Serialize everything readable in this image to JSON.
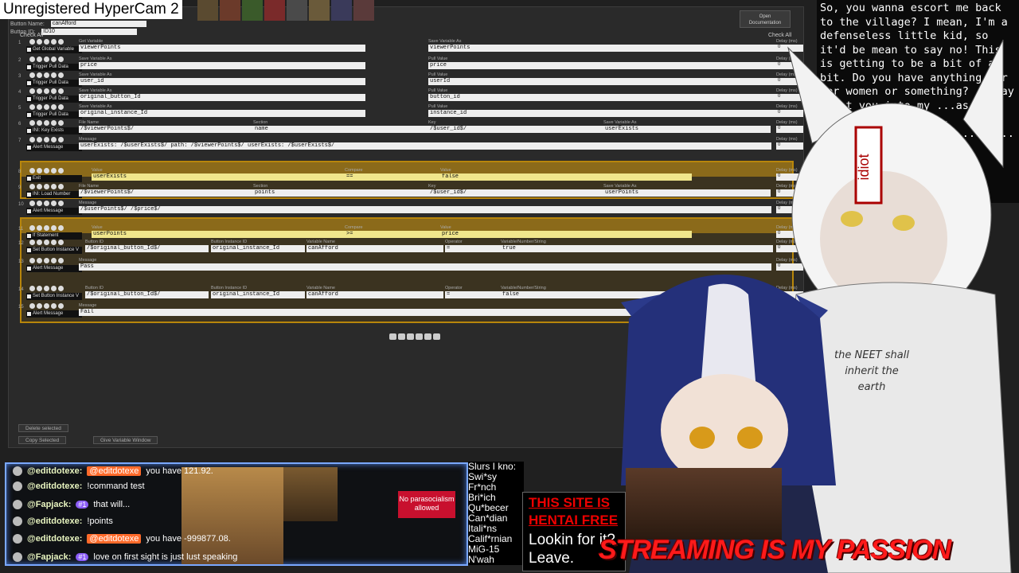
{
  "watermark": "Unregistered HyperCam 2",
  "editor": {
    "button_name_label": "Button Name:",
    "button_name_value": "canAfford",
    "button_id_label": "Button ID:",
    "button_id_value": "ID10",
    "check_all": "Check All",
    "check_all_right": "Check All",
    "open_doc": "Open\nDocumentation",
    "delete_selected": "Delete selected",
    "copy_selected": "Copy Selected",
    "global_vars": "Give Variable Window",
    "delay_caption": "Delay (ms)",
    "off_caption": "Off",
    "delay_val": "0",
    "rows": [
      {
        "idx": "1",
        "label": "Get Global Variable",
        "f1cap": "Get Variable",
        "f1": "viewerPoints",
        "f2cap": "Save Variable As",
        "f2": "viewerPoints"
      },
      {
        "idx": "2",
        "label": "Trigger Pull Data",
        "f1cap": "Save Variable As",
        "f1": "price",
        "f2cap": "Pull Value",
        "f2": "price"
      },
      {
        "idx": "3",
        "label": "Trigger Pull Data",
        "f1cap": "Save Variable As",
        "f1": "user_id",
        "f2cap": "Pull Value",
        "f2": "userId"
      },
      {
        "idx": "4",
        "label": "Trigger Pull Data",
        "f1cap": "Save Variable As",
        "f1": "original_button_Id",
        "f2cap": "Pull Value",
        "f2": "button_id"
      },
      {
        "idx": "5",
        "label": "Trigger Pull Data",
        "f1cap": "Save Variable As",
        "f1": "original_instance_Id",
        "f2cap": "Pull Value",
        "f2": "instance_id"
      },
      {
        "idx": "6",
        "label": "INI: Key Exists",
        "f1cap": "File Name",
        "f1": "/$viewerPoints$/",
        "f2cap": "Section",
        "f2": "name",
        "f3cap": "Key",
        "f3": "/$user_id$/",
        "f4cap": "Save Variable As",
        "f4": "userExists"
      },
      {
        "idx": "7",
        "label": "Alert Message",
        "f1cap": "Message",
        "f1": "userExists: /$userExists$/ path: /$viewerPoints$/ userExists: /$userExists$/"
      },
      {
        "idx": "8",
        "label": "Exit",
        "f1cap": "Value",
        "f1": "userExists",
        "f2cap": "Compare",
        "f2": "==",
        "f3cap": "Value",
        "f3": "false"
      },
      {
        "idx": "9",
        "label": "INI: Load Number",
        "f1cap": "File Name",
        "f1": "/$viewerPoints$/",
        "f2cap": "Section",
        "f2": "points",
        "f3cap": "Key",
        "f3": "/$user_id$/",
        "f4cap": "Save Variable As",
        "f4": "userPoints"
      },
      {
        "idx": "10",
        "label": "Alert Message",
        "f1cap": "Message",
        "f1": "/$userPoints$/ /$price$/"
      },
      {
        "idx": "11",
        "label": "If Statement",
        "f1cap": "Value",
        "f1": "userPoints",
        "f2cap": "Compare",
        "f2": ">=",
        "f3cap": "Value",
        "f3": "price"
      },
      {
        "idx": "12",
        "label": "Set Button Instance V",
        "f1cap": "Button ID",
        "f1": "/$original_button_Id$/",
        "f2cap": "Button Instance ID",
        "f2": "original_instance_Id",
        "f3cap": "Variable Name",
        "f3": "canAfford",
        "f4cap": "Operator",
        "f4": "=",
        "f5cap": "Variable/Number/String",
        "f5": "true"
      },
      {
        "idx": "13",
        "label": "Alert Message",
        "f1cap": "Message",
        "f1": "Pass"
      },
      {
        "idx": "14",
        "label": "Set Button Instance V",
        "f1cap": "Button ID",
        "f1": "/$original_button_Id$/",
        "f2cap": "Button Instance ID",
        "f2": "original_instance_Id",
        "f3cap": "Variable Name",
        "f3": "canAfford",
        "f4cap": "Operator",
        "f4": "=",
        "f5cap": "Variable/Number/String",
        "f5": "false"
      },
      {
        "idx": "15",
        "label": "Alert Message",
        "f1cap": "Message",
        "f1": "Fail"
      }
    ],
    "else_label": "Else"
  },
  "overlay_text": "So, you wanna escort me back to the village? I mean, I'm a defenseless little kid, so it'd be mean to say no! This is getting to be a bit of a bit. Do you have anything for her women or something? ...may I eat you into my ...as you wish. ...ell-done... ...medium- ...any of ...ust...",
  "shirt_text": "the NEET shall inherit the earth",
  "forehead_text": "idiot",
  "chat": {
    "lines": [
      {
        "user": "@editdotexe:",
        "mention": "@editdotexe",
        "text": "you have 121.92."
      },
      {
        "user": "@editdotexe:",
        "text": "!command test"
      },
      {
        "user": "@Fapjack:",
        "badge": "#1",
        "text": "that will..."
      },
      {
        "user": "@editdotexe:",
        "text": "!points"
      },
      {
        "user": "@editdotexe:",
        "mention": "@editdotexe",
        "text": "you have -999877.08."
      },
      {
        "user": "@Fapjack:",
        "badge": "#1",
        "text": "love on first sight is just lust speaking"
      }
    ],
    "no_parasocial": "No parasocialism allowed"
  },
  "slurs": [
    "Slurs I kno:",
    "Swi*sy",
    "Fr*nch",
    "Bri*ich",
    "Qu*becer",
    "Can*dian",
    "Itali*ns",
    "Calif*rnian",
    "MiG-15",
    "N'wah"
  ],
  "this_site": {
    "l1": "THIS SITE IS",
    "l2": "HENTAI FREE",
    "l3": "Lookin for it?",
    "l4": "Leave."
  },
  "passion": "STREAMING IS MY PASSION",
  "colors": {
    "accent_gold": "#b8860b",
    "chat_border": "#7aa8ff",
    "passion_red": "#ff1a1a"
  }
}
